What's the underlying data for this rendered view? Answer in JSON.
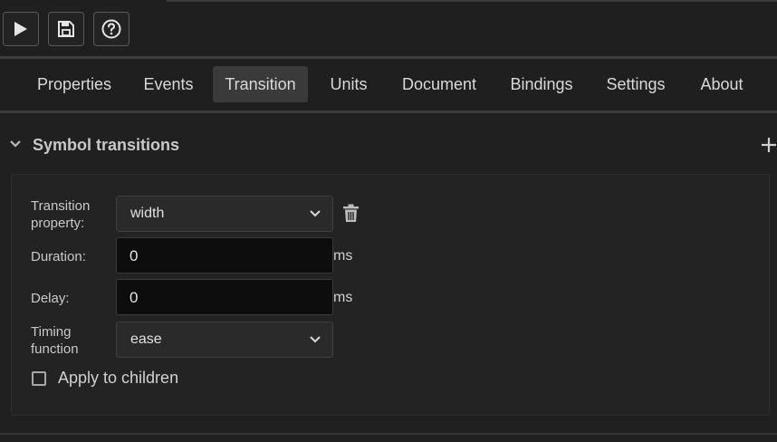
{
  "toolbar": {
    "buttons": [
      {
        "name": "play",
        "icon": "play-icon"
      },
      {
        "name": "save",
        "icon": "save-icon"
      },
      {
        "name": "help",
        "icon": "help-circle-icon"
      }
    ]
  },
  "tabs": [
    {
      "label": "Properties",
      "active": false
    },
    {
      "label": "Events",
      "active": false
    },
    {
      "label": "Transition",
      "active": true
    },
    {
      "label": "Units",
      "active": false
    },
    {
      "label": "Document",
      "active": false
    },
    {
      "label": "Bindings",
      "active": false
    },
    {
      "label": "Settings",
      "active": false
    },
    {
      "label": "About",
      "active": false
    }
  ],
  "section": {
    "title": "Symbol transitions",
    "expanded": true
  },
  "form": {
    "transition_property": {
      "label_line1": "Transition",
      "label_line2": "property:",
      "value": "width"
    },
    "duration": {
      "label": "Duration:",
      "value": "0",
      "unit": "ms"
    },
    "delay": {
      "label": "Delay:",
      "value": "0",
      "unit": "ms"
    },
    "timing_function": {
      "label_line1": "Timing",
      "label_line2": "function",
      "value": "ease"
    },
    "apply_to_children": {
      "label": "Apply to children",
      "checked": false
    }
  },
  "colors": {
    "background": "#202020",
    "active_tab": "#3a3a3a",
    "input_bg": "#0d0d0d"
  }
}
